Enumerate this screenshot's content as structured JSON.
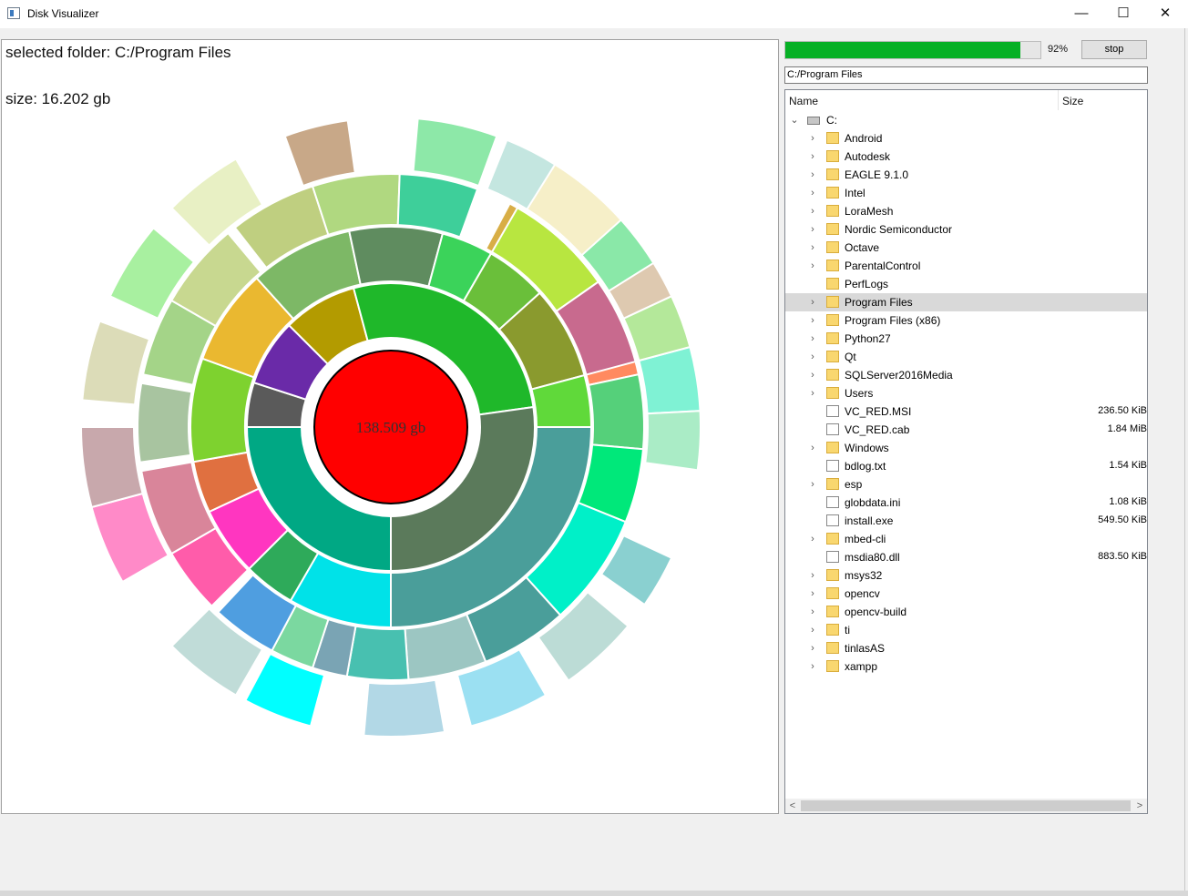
{
  "window": {
    "title": "Disk Visualizer",
    "minimize_glyph": "—",
    "maximize_glyph": "☐",
    "close_glyph": "✕"
  },
  "viz": {
    "selected_label": "selected folder: C:/Program Files",
    "size_label": "size: 16.202 gb",
    "center_label": "138.509 gb",
    "center_color": "#ff0000"
  },
  "controls": {
    "progress": 0.92,
    "progress_label": "92%",
    "progress_color": "#06b025",
    "stop_label": "stop",
    "path_value": "C:/Program Files"
  },
  "tree": {
    "columns": {
      "name": "Name",
      "size": "Size"
    },
    "root": "C:",
    "items": [
      {
        "name": "Android",
        "kind": "folder",
        "expandable": true,
        "size": ""
      },
      {
        "name": "Autodesk",
        "kind": "folder",
        "expandable": true,
        "size": ""
      },
      {
        "name": "EAGLE 9.1.0",
        "kind": "folder",
        "expandable": true,
        "size": ""
      },
      {
        "name": "Intel",
        "kind": "folder",
        "expandable": true,
        "size": ""
      },
      {
        "name": "LoraMesh",
        "kind": "folder",
        "expandable": true,
        "size": ""
      },
      {
        "name": "Nordic Semiconductor",
        "kind": "folder",
        "expandable": true,
        "size": ""
      },
      {
        "name": "Octave",
        "kind": "folder",
        "expandable": true,
        "size": ""
      },
      {
        "name": "ParentalControl",
        "kind": "folder",
        "expandable": true,
        "size": ""
      },
      {
        "name": "PerfLogs",
        "kind": "folder",
        "expandable": false,
        "size": ""
      },
      {
        "name": "Program Files",
        "kind": "folder",
        "expandable": true,
        "size": "",
        "selected": true
      },
      {
        "name": "Program Files (x86)",
        "kind": "folder",
        "expandable": true,
        "size": ""
      },
      {
        "name": "Python27",
        "kind": "folder",
        "expandable": true,
        "size": ""
      },
      {
        "name": "Qt",
        "kind": "folder",
        "expandable": true,
        "size": ""
      },
      {
        "name": "SQLServer2016Media",
        "kind": "folder",
        "expandable": true,
        "size": ""
      },
      {
        "name": "Users",
        "kind": "folder",
        "expandable": true,
        "size": ""
      },
      {
        "name": "VC_RED.MSI",
        "kind": "file",
        "expandable": false,
        "size": "236.50 KiB"
      },
      {
        "name": "VC_RED.cab",
        "kind": "file",
        "expandable": false,
        "size": "1.84 MiB"
      },
      {
        "name": "Windows",
        "kind": "folder",
        "expandable": true,
        "size": ""
      },
      {
        "name": "bdlog.txt",
        "kind": "file",
        "expandable": false,
        "size": "1.54 KiB"
      },
      {
        "name": "esp",
        "kind": "folder",
        "expandable": true,
        "size": ""
      },
      {
        "name": "globdata.ini",
        "kind": "file",
        "expandable": false,
        "size": "1.08 KiB"
      },
      {
        "name": "install.exe",
        "kind": "file",
        "expandable": false,
        "size": "549.50 KiB"
      },
      {
        "name": "mbed-cli",
        "kind": "folder",
        "expandable": true,
        "size": ""
      },
      {
        "name": "msdia80.dll",
        "kind": "file",
        "expandable": false,
        "size": "883.50 KiB"
      },
      {
        "name": "msys32",
        "kind": "folder",
        "expandable": true,
        "size": ""
      },
      {
        "name": "opencv",
        "kind": "folder",
        "expandable": true,
        "size": ""
      },
      {
        "name": "opencv-build",
        "kind": "folder",
        "expandable": true,
        "size": ""
      },
      {
        "name": "ti",
        "kind": "folder",
        "expandable": true,
        "size": ""
      },
      {
        "name": "tinlasAS",
        "kind": "folder",
        "expandable": true,
        "size": ""
      },
      {
        "name": "xampp",
        "kind": "folder",
        "expandable": true,
        "size": ""
      }
    ]
  },
  "sunburst": {
    "rings": [
      [
        {
          "start": -90,
          "end": 0,
          "color": "#5b7a5b"
        },
        {
          "start": 0,
          "end": 180,
          "color": "#00a884"
        },
        {
          "start": 180,
          "end": 198,
          "color": "#5a5a5a"
        },
        {
          "start": 198,
          "end": 225,
          "color": "#6a2aa8"
        },
        {
          "start": 225,
          "end": 255,
          "color": "#b39b00"
        },
        {
          "start": 255,
          "end": 352,
          "color": "#1fb82a"
        },
        {
          "start": 352,
          "end": 90,
          "color": "#5b7a5b"
        }
      ],
      [
        {
          "start": -75,
          "end": -67,
          "color": "#8a9a2e"
        },
        {
          "start": -67,
          "end": -57,
          "color": "#944a4a"
        },
        {
          "start": -57,
          "end": -40,
          "color": "#2a5ba0"
        },
        {
          "start": -40,
          "end": -18,
          "color": "#5b7a5b"
        },
        {
          "start": -18,
          "end": 0,
          "color": "#78d632"
        },
        {
          "start": 0,
          "end": 90,
          "color": "#4a9e9a"
        },
        {
          "start": 90,
          "end": 120,
          "color": "#00e2e8"
        },
        {
          "start": 120,
          "end": 135,
          "color": "#2eaa5a"
        },
        {
          "start": 135,
          "end": 155,
          "color": "#ff36c0"
        },
        {
          "start": 155,
          "end": 170,
          "color": "#e07040"
        },
        {
          "start": 170,
          "end": 200,
          "color": "#7ed22f"
        },
        {
          "start": 200,
          "end": 228,
          "color": "#eab830"
        },
        {
          "start": 228,
          "end": 258,
          "color": "#7db866"
        },
        {
          "start": 258,
          "end": 285,
          "color": "#5f8c5f"
        },
        {
          "start": 285,
          "end": 300,
          "color": "#3bd35a"
        },
        {
          "start": 300,
          "end": 318,
          "color": "#6abf3a"
        },
        {
          "start": 318,
          "end": 345,
          "color": "#8a9a2e"
        },
        {
          "start": 345,
          "end": 360,
          "color": "#60d93a"
        }
      ],
      [
        {
          "start": -62,
          "end": -30,
          "color": "#d8ae46"
        },
        {
          "start": -30,
          "end": -12,
          "color": "#ff8a60"
        },
        {
          "start": -12,
          "end": 5,
          "color": "#55d07a"
        },
        {
          "start": 5,
          "end": 22,
          "color": "#00e87a"
        },
        {
          "start": 22,
          "end": 48,
          "color": "#00f0c8"
        },
        {
          "start": 48,
          "end": 68,
          "color": "#4a9e9a"
        },
        {
          "start": 68,
          "end": 86,
          "color": "#9cc6c2"
        },
        {
          "start": 86,
          "end": 100,
          "color": "#48c0b0"
        },
        {
          "start": 100,
          "end": 108,
          "color": "#7aa4b4"
        },
        {
          "start": 108,
          "end": 118,
          "color": "#7bd8a0"
        },
        {
          "start": 118,
          "end": 133,
          "color": "#4f9ee0"
        },
        {
          "start": 135,
          "end": 150,
          "color": "#ff5caa"
        },
        {
          "start": 150,
          "end": 170,
          "color": "#d9859a"
        },
        {
          "start": 172,
          "end": 190,
          "color": "#a8c4a0"
        },
        {
          "start": 192,
          "end": 210,
          "color": "#a4d488"
        },
        {
          "start": 210,
          "end": 230,
          "color": "#c8d890"
        },
        {
          "start": 232,
          "end": 252,
          "color": "#bfcf80"
        },
        {
          "start": 252,
          "end": 272,
          "color": "#b0d880"
        },
        {
          "start": 272,
          "end": 290,
          "color": "#3ecf9a"
        },
        {
          "start": 300,
          "end": 325,
          "color": "#b8e640"
        },
        {
          "start": 325,
          "end": 345,
          "color": "#c86a8e"
        }
      ],
      [
        {
          "start": -60,
          "end": -40,
          "color": "#f6efc8"
        },
        {
          "start": -40,
          "end": -25,
          "color": "#dec9b0"
        },
        {
          "start": -15,
          "end": -3,
          "color": "#7ff2d4"
        },
        {
          "start": -3,
          "end": 8,
          "color": "#aaecc6"
        },
        {
          "start": 25,
          "end": 35,
          "color": "#8ad0d0"
        },
        {
          "start": 40,
          "end": 55,
          "color": "#bcdcd6"
        },
        {
          "start": 60,
          "end": 75,
          "color": "#9be0f2"
        },
        {
          "start": 80,
          "end": 95,
          "color": "#b2d8e6"
        },
        {
          "start": 105,
          "end": 118,
          "color": "#00ffff"
        },
        {
          "start": 120,
          "end": 135,
          "color": "#c0dcd8"
        },
        {
          "start": 150,
          "end": 165,
          "color": "#ff8ac8"
        },
        {
          "start": 165,
          "end": 180,
          "color": "#c8a8ac"
        },
        {
          "start": 185,
          "end": 200,
          "color": "#dcdcb8"
        },
        {
          "start": 205,
          "end": 220,
          "color": "#a8f0a0"
        },
        {
          "start": 225,
          "end": 240,
          "color": "#e8f0c4"
        },
        {
          "start": 250,
          "end": 262,
          "color": "#c8a888"
        },
        {
          "start": 275,
          "end": 290,
          "color": "#8de8a8"
        },
        {
          "start": 292,
          "end": 302,
          "color": "#c4e6e0"
        },
        {
          "start": 318,
          "end": 328,
          "color": "#8ae8a8"
        },
        {
          "start": 335,
          "end": 345,
          "color": "#b4e89a"
        }
      ]
    ]
  }
}
